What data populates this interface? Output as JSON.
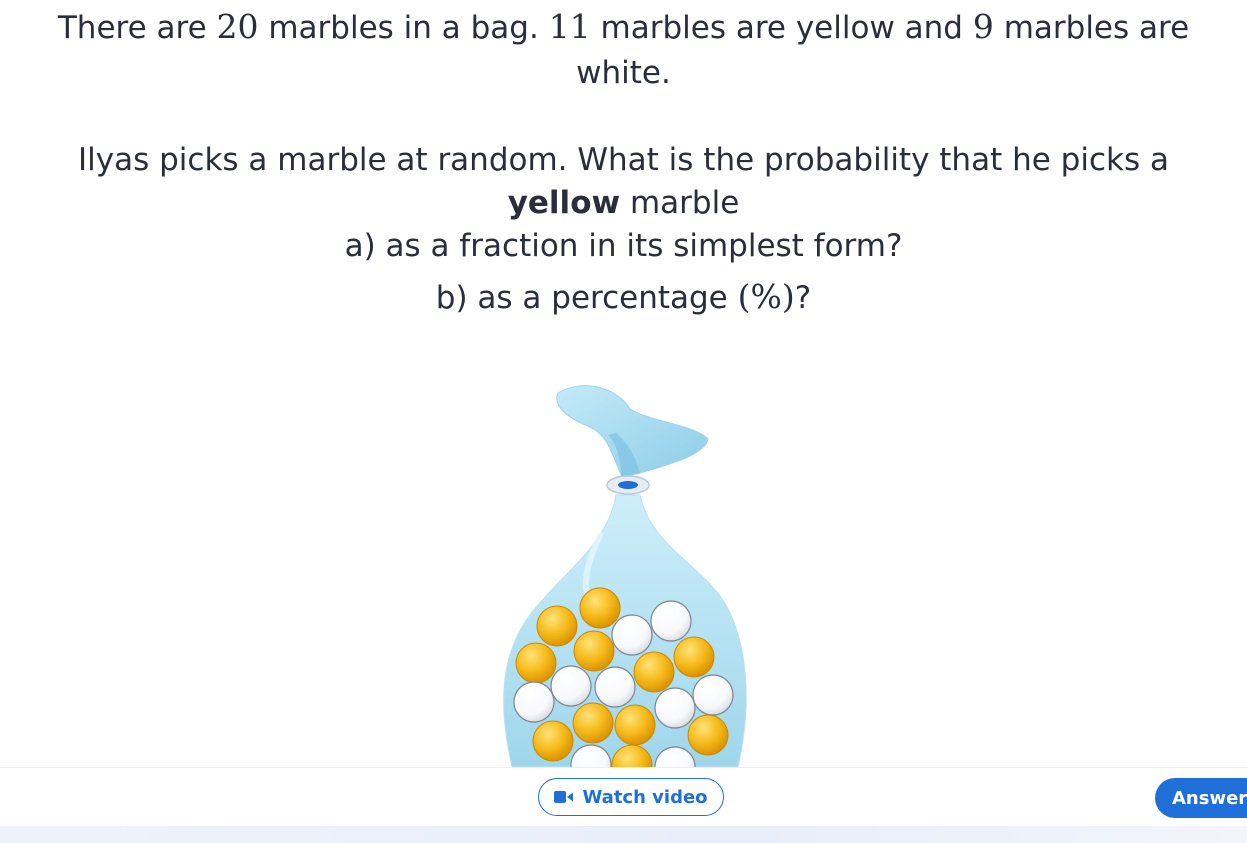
{
  "question": {
    "line1": {
      "p1": "There are ",
      "total": "20",
      "p2": " marbles in a bag. ",
      "yellow_count": "11",
      "p3": " marbles are yellow and ",
      "white_count": "9",
      "p4": " marbles are"
    },
    "line2": "white.",
    "line3": "Ilyas picks a marble at random. What is the probability that he picks a",
    "line4": {
      "bold": "yellow",
      "rest": " marble"
    },
    "part_a": "a) as a fraction in its simplest form?",
    "part_b": {
      "prefix": "b) as a percentage ",
      "symbol": "(%)",
      "suffix": "?"
    }
  },
  "figure": {
    "bag_color": "#aee0f2",
    "yellow_marble_color": "#f4b400",
    "white_marble_color": "#ffffff"
  },
  "footer": {
    "watch_video_label": "Watch video",
    "watch_video_icon": "video-camera-icon",
    "answer_label": "Answer"
  },
  "colors": {
    "accent": "#1f6fd8",
    "text": "#2a2e3a"
  }
}
